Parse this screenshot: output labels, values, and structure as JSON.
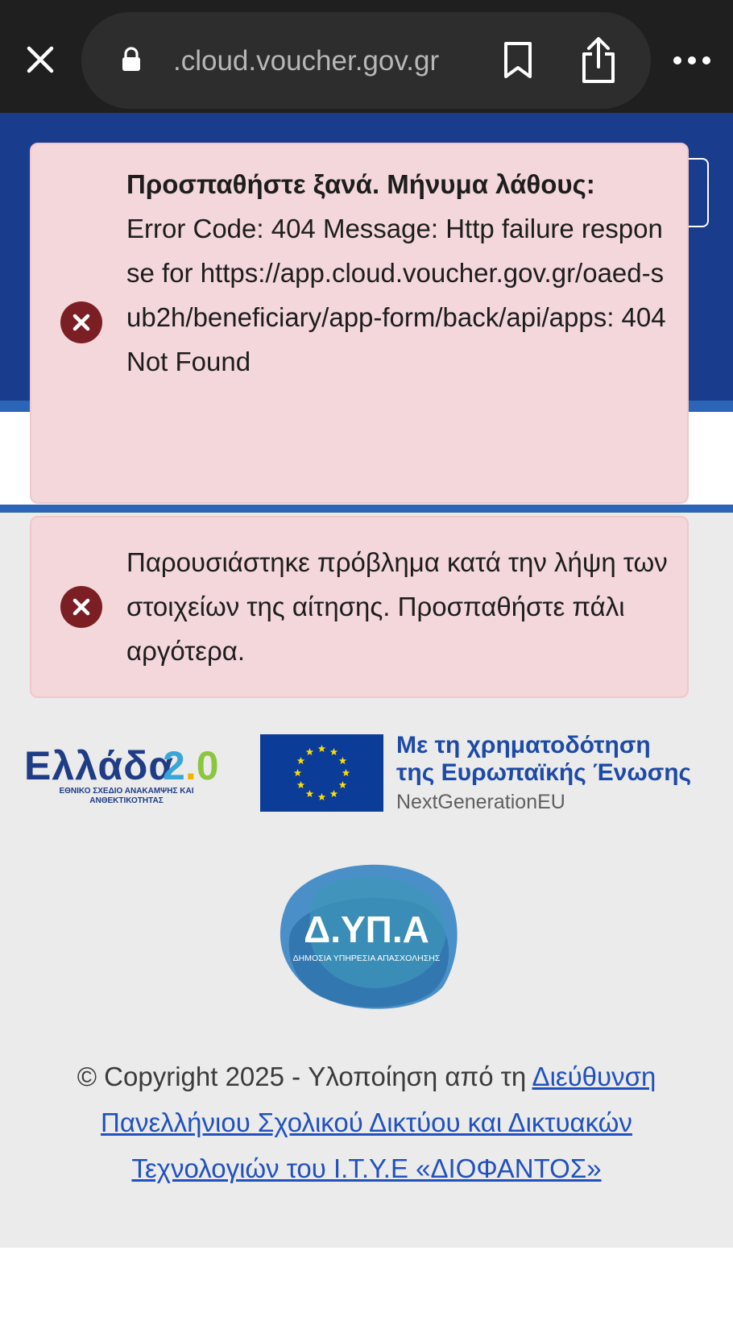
{
  "browser": {
    "url": ".cloud.voucher.gov.gr",
    "close_icon": "close-icon",
    "lock_icon": "lock-icon",
    "bookmark_icon": "bookmark-icon",
    "share_icon": "share-icon",
    "more_icon": "more-options-icon"
  },
  "alerts": [
    {
      "title": "Προσπαθήστε ξανά. Μήνυμα λάθους:",
      "message": "Error Code: 404 Message: Http failure response for https://app.cloud.voucher.gov.gr/oaed-sub2h/beneficiary/app-form/back/api/apps: 404 Not Found",
      "icon": "error-icon"
    },
    {
      "message": "Παρουσιάστηκε πρόβλημα κατά την λήψη των στοιχείων της αίτησης. Προσπαθήστε πάλι αργότερα.",
      "icon": "error-icon"
    }
  ],
  "logos": {
    "greece_name": "Ελλάδα",
    "greece_number": "2.0",
    "greece_subtitle": "ΕΘΝΙΚΟ ΣΧΕΔΙΟ ΑΝΑΚΑΜΨΗΣ ΚΑΙ ΑΝΘΕΚΤΙΚΟΤΗΤΑΣ",
    "eu_line1": "Με τη χρηματοδότηση",
    "eu_line2": "της Ευρωπαϊκής Ένωσης",
    "eu_line3": "NextGenerationEU",
    "dypa_name": "Δ.ΥΠ.Α",
    "dypa_subtitle": "ΔΗΜΟΣΙΑ ΥΠΗΡΕΣΙΑ ΑΠΑΣΧΟΛΗΣΗΣ"
  },
  "footer": {
    "text": "© Copyright 2025 - Υλοποίηση από τη ",
    "link": "Διεύθυνση Πανελλήνιου Σχολικού Δικτύου και Δικτυακών Τεχνολογιών του Ι.Τ.Υ.Ε «ΔΙΟΦΑΝΤΟΣ»"
  },
  "colors": {
    "chrome_bg": "#1f1f1f",
    "header_blue": "#1a3c8c",
    "alert_bg": "#f3d7da",
    "alert_icon": "#7b1f24",
    "link": "#2051bf"
  }
}
